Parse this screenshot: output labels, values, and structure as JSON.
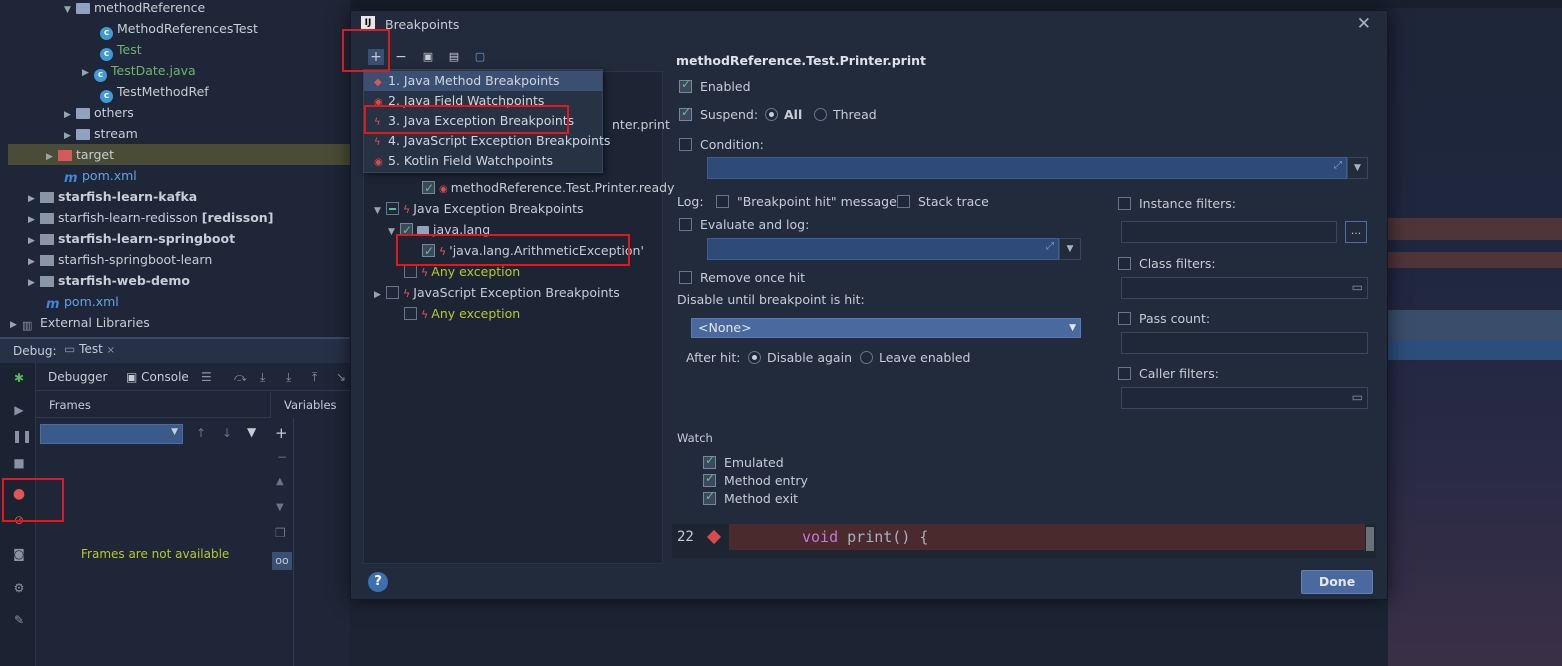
{
  "project_tree": {
    "items": [
      {
        "label": "methodReference"
      },
      {
        "label": "MethodReferencesTest"
      },
      {
        "label": "Test"
      },
      {
        "label": "TestDate.java"
      },
      {
        "label": "TestMethodRef"
      },
      {
        "label": "others"
      },
      {
        "label": "stream"
      },
      {
        "label": "target"
      },
      {
        "label": "pom.xml"
      },
      {
        "label": "starfish-learn-kafka"
      },
      {
        "label": "starfish-learn-redisson",
        "suffix": "[redisson]"
      },
      {
        "label": "starfish-learn-springboot"
      },
      {
        "label": "starfish-springboot-learn"
      },
      {
        "label": "starfish-web-demo"
      },
      {
        "label": "pom.xml"
      },
      {
        "label": "External Libraries"
      }
    ]
  },
  "debug": {
    "label": "Debug:",
    "run_tab": "Test",
    "tabs": {
      "debugger": "Debugger",
      "console": "Console"
    },
    "frames_label": "Frames",
    "variables_label": "Variables",
    "frames_empty": "Frames are not available"
  },
  "dialog": {
    "title": "Breakpoints",
    "popup_items": [
      {
        "label": "1. Java Method Breakpoints"
      },
      {
        "label": "2. Java Field Watchpoints"
      },
      {
        "label": "3. Java Exception Breakpoints"
      },
      {
        "label": "4. JavaScript Exception Breakpoints"
      },
      {
        "label": "5. Kotlin Field Watchpoints"
      }
    ],
    "tree": {
      "partial_item": "nter.print",
      "printer_ready": "methodReference.Test.Printer.ready",
      "java_exc_group": "Java Exception Breakpoints",
      "java_lang": "java.lang",
      "arith": "'java.lang.ArithmeticException'",
      "any_exception_1": "Any exception",
      "js_exc_group": "JavaScript Exception Breakpoints",
      "any_exception_2": "Any exception"
    },
    "details": {
      "title": "methodReference.Test.Printer.print",
      "enabled": "Enabled",
      "suspend": "Suspend:",
      "all": "All",
      "thread": "Thread",
      "condition": "Condition:",
      "log": "Log:",
      "breakpoint_hit_msg": "\"Breakpoint hit\" message",
      "stack_trace": "Stack trace",
      "evaluate_log": "Evaluate and log:",
      "remove_once_hit": "Remove once hit",
      "disable_until": "Disable until breakpoint is hit:",
      "none_option": "<None>",
      "after_hit": "After hit:",
      "disable_again": "Disable again",
      "leave_enabled": "Leave enabled",
      "instance_filters": "Instance filters:",
      "class_filters": "Class filters:",
      "pass_count": "Pass count:",
      "caller_filters": "Caller filters:",
      "more_btn": "...",
      "watch": "Watch",
      "emulated": "Emulated",
      "method_entry": "Method entry",
      "method_exit": "Method exit"
    },
    "code": {
      "line_number": "22",
      "keyword": "void",
      "rest": " print() {"
    },
    "help": "?",
    "done": "Done"
  }
}
